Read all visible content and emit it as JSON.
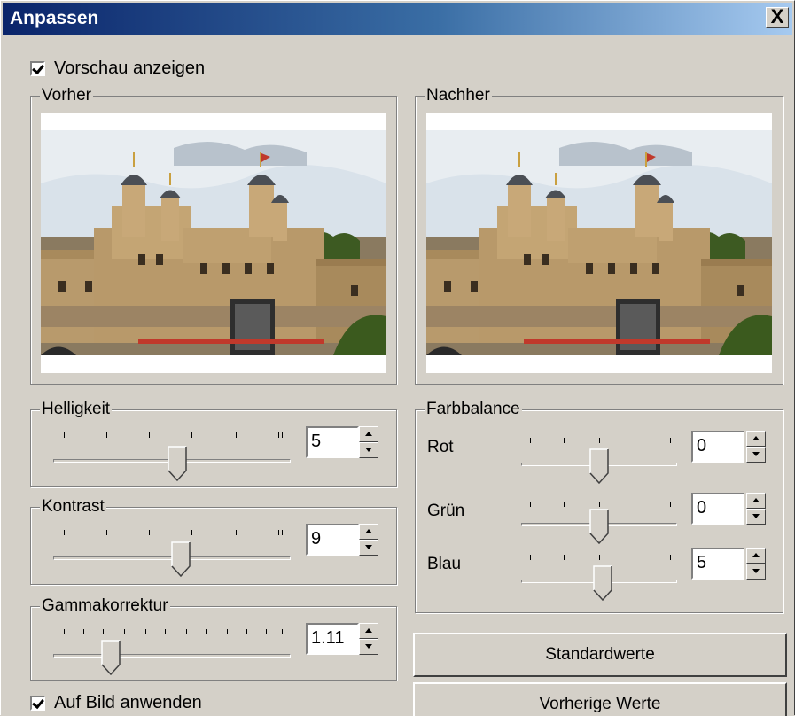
{
  "window": {
    "title": "Anpassen",
    "close_label": "X"
  },
  "preview_checkbox": {
    "label": "Vorschau anzeigen",
    "checked": true
  },
  "before_group": {
    "label": "Vorher"
  },
  "after_group": {
    "label": "Nachher"
  },
  "brightness": {
    "label": "Helligkeit",
    "value": "5"
  },
  "contrast": {
    "label": "Kontrast",
    "value": "9"
  },
  "gamma": {
    "label": "Gammakorrektur",
    "value": "1.11"
  },
  "color_balance": {
    "label": "Farbbalance",
    "red": {
      "label": "Rot",
      "value": "0"
    },
    "green": {
      "label": "Grün",
      "value": "0"
    },
    "blue": {
      "label": "Blau",
      "value": "5"
    }
  },
  "apply_checkbox": {
    "label": "Auf Bild anwenden",
    "checked": true
  },
  "buttons": {
    "defaults": "Standardwerte",
    "previous": "Vorherige Werte"
  }
}
